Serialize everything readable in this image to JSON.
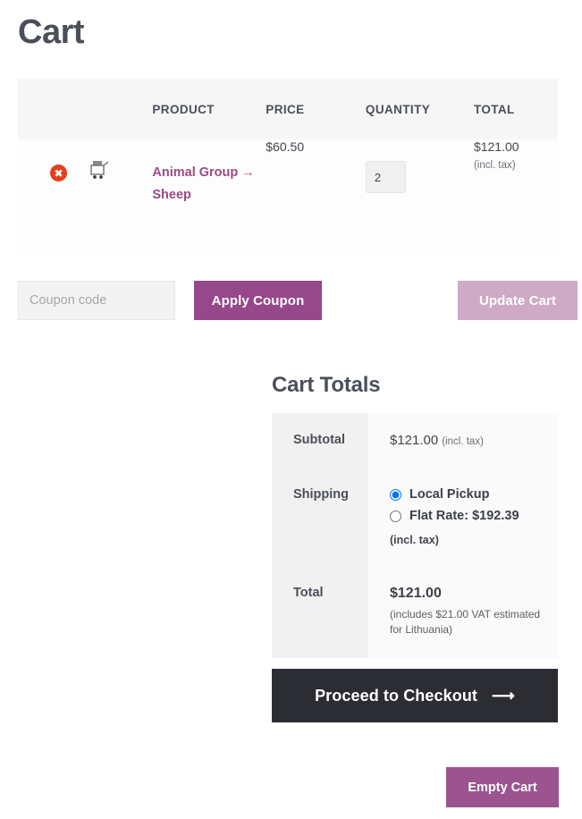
{
  "page": {
    "title": "Cart"
  },
  "cart_table": {
    "headers": {
      "remove": "",
      "thumbnail": "",
      "product": "PRODUCT",
      "price": "PRICE",
      "quantity": "QUANTITY",
      "total": "TOTAL"
    },
    "rows": [
      {
        "remove_label": "✖",
        "thumbnail_icon": "cart-placeholder-icon",
        "product_name": "Animal Group",
        "product_arrow": "→",
        "product_variation": "Sheep",
        "price": "$60.50",
        "quantity": "2",
        "total": "$121.00",
        "total_tax_note": "(incl. tax)"
      }
    ]
  },
  "actions": {
    "coupon_placeholder": "Coupon code",
    "coupon_value": "",
    "apply_coupon_label": "Apply Coupon",
    "update_cart_label": "Update Cart"
  },
  "totals": {
    "title": "Cart Totals",
    "subtotal_label": "Subtotal",
    "subtotal_amount": "$121.00",
    "subtotal_tax_note": "(incl. tax)",
    "shipping_label": "Shipping",
    "shipping_options": [
      {
        "label": "Local Pickup",
        "selected": true
      },
      {
        "label": "Flat Rate: $192.39",
        "selected": false
      }
    ],
    "shipping_tax_note": "(incl. tax)",
    "total_label": "Total",
    "total_amount": "$121.00",
    "total_vat_note": "(includes $21.00 VAT estimated for Lithuania)"
  },
  "checkout": {
    "label": "Proceed to Checkout",
    "arrow": "⟶"
  },
  "empty_cart": {
    "label": "Empty Cart"
  },
  "colors": {
    "accent_purple": "#96488a",
    "accent_purple_light": "#cfaac6",
    "remove_red": "#e2401c",
    "checkout_dark": "#2b2d32",
    "link_purple": "#9b4b83"
  }
}
